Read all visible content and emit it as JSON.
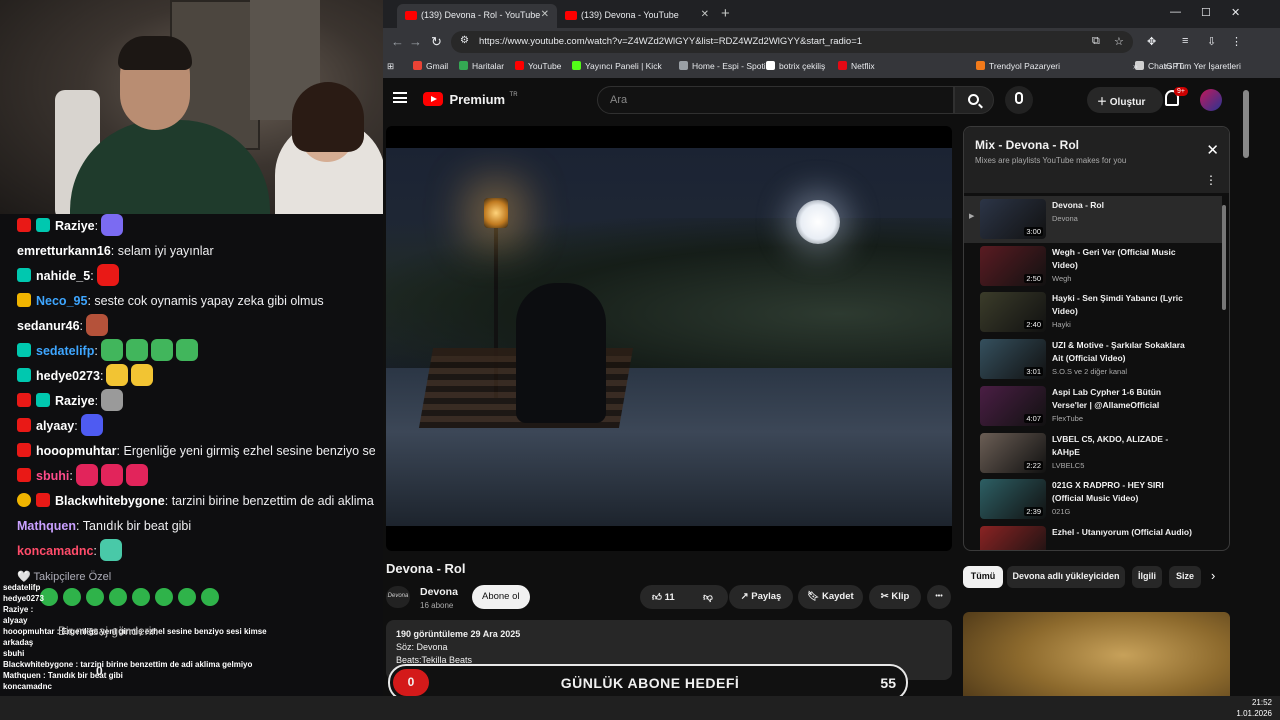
{
  "stream": {
    "chat": [
      {
        "badge": "b-red",
        "badge2": "b-teal",
        "user": "Raziye",
        "color": "#ffffff",
        "sep": ":",
        "text": "",
        "emotes": [
          "#7b6bf2"
        ]
      },
      {
        "badge": "",
        "badge2": "",
        "user": "emretturkann16",
        "color": "#ffffff",
        "sep": ":",
        "text": " selam iyi yayınlar",
        "emotes": []
      },
      {
        "badge": "b-teal",
        "badge2": "",
        "user": "nahide_5",
        "color": "#ffffff",
        "sep": ":",
        "text": "",
        "emotes": [
          "#e91916"
        ]
      },
      {
        "badge": "b-gold",
        "badge2": "",
        "user": "Neco_95",
        "color": "#3ea6ff",
        "sep": ":",
        "text": " seste cok oynamis yapay zeka gibi olmus",
        "emotes": []
      },
      {
        "badge": "",
        "badge2": "",
        "user": "sedanur46",
        "color": "#ffffff",
        "sep": ":",
        "text": "",
        "emotes": [
          "#b5523a"
        ]
      },
      {
        "badge": "b-teal",
        "badge2": "",
        "user": "sedatelifp",
        "color": "#3ea6ff",
        "sep": ":",
        "text": "",
        "emotes": [
          "#41b65c",
          "#41b65c",
          "#41b65c",
          "#41b65c"
        ]
      },
      {
        "badge": "b-teal",
        "badge2": "",
        "user": "hedye0273",
        "color": "#ffffff",
        "sep": ":",
        "text": "",
        "emotes": [
          "#f2c433",
          "#f2c433"
        ]
      },
      {
        "badge": "b-red",
        "badge2": "b-teal",
        "user": "Raziye",
        "color": "#ffffff",
        "sep": ":",
        "text": "",
        "emotes": [
          "#9a9a9a"
        ]
      },
      {
        "badge": "b-red",
        "badge2": "",
        "user": "alyaay",
        "color": "#ffffff",
        "sep": ":",
        "text": "",
        "emotes": [
          "#4e5bf2"
        ]
      },
      {
        "badge": "b-red",
        "badge2": "",
        "user": "hooopmuhtar",
        "color": "#ffffff",
        "sep": ":",
        "text": " Ergenliğe yeni girmiş ezhel sesine benziyo sesi kimse",
        "emotes": []
      },
      {
        "badge": "b-red",
        "badge2": "",
        "user": "sbuhi",
        "color": "#ff4c8b",
        "sep": ":",
        "text": "",
        "emotes": [
          "#e2245b",
          "#e2245b",
          "#e2245b"
        ]
      },
      {
        "badge": "b-coin",
        "badge2": "b-red",
        "user": "Blackwhitebygone",
        "color": "#ffffff",
        "sep": ":",
        "text": " tarzini birine benzettim de adi aklima gelmiyo",
        "emotes": []
      },
      {
        "badge": "",
        "badge2": "",
        "user": "Mathquen",
        "color": "#c9a0ff",
        "sep": ":",
        "text": " Tanıdık bir beat gibi",
        "emotes": []
      },
      {
        "badge": "",
        "badge2": "",
        "user": "koncamadnc",
        "color": "#ff4c6a",
        "sep": ":",
        "text": "",
        "emotes": [
          "#49c9a8"
        ]
      }
    ],
    "followers_only": "🤍 Takipçilere Özel",
    "send_placeholder": "Bir mesaj gönderin",
    "mini_chat": [
      "sedatelifp",
      "hedye0273",
      "Raziye :",
      "alyaay",
      "hooopmuhtar : Ergenliğe yeni girmiş ezhel sesine benziyo sesi kimse",
      "arkadaş",
      "sbuhi",
      "Blackwhitebygone : tarzini birine benzettim de adi aklima gelmiyo",
      "Mathquen : Tanıdık bir beat gibi",
      "koncamadnc"
    ],
    "counter": "0"
  },
  "browser": {
    "tabs": [
      {
        "title": "(139) Devona - Rol - YouTube"
      },
      {
        "title": "(139) Devona - YouTube"
      }
    ],
    "url": "https://www.youtube.com/watch?v=Z4WZd2WlGYY&list=RDZ4WZd2WlGYY&start_radio=1",
    "bookmarks": [
      {
        "label": "Gmail",
        "color": "#ea4335"
      },
      {
        "label": "Haritalar",
        "color": "#34a853"
      },
      {
        "label": "YouTube",
        "color": "#ff0000"
      },
      {
        "label": "Yayıncı Paneli | Kick",
        "color": "#53fc18"
      },
      {
        "label": "Home - Espi - Spoti...",
        "color": "#9aa0a6"
      },
      {
        "label": "botrix çekiliş",
        "color": "#ffffff"
      },
      {
        "label": "Netflix",
        "color": "#e50914"
      },
      {
        "label": "Trendyol Pazaryeri",
        "color": "#f27a1a"
      },
      {
        "label": "ChatGPT",
        "color": "#d0d0d0"
      }
    ],
    "all_bookmarks": "Tüm Yer İşaretleri"
  },
  "youtube": {
    "logo_text": "Premium",
    "logo_region": "TR",
    "search_placeholder": "Ara",
    "create_label": "Oluştur",
    "notif_count": "9+",
    "video": {
      "title": "Devona - Rol",
      "channel": "Devona",
      "channel_avatar_text": "Devona",
      "subs": "16 abone",
      "subscribe": "Abone ol",
      "likes": "11",
      "share": "Paylaş",
      "save": "Kaydet",
      "clip": "Klip",
      "more": "•••",
      "views_date": "190 görüntüleme  29 Ara 2025",
      "desc_line1": "Söz: Devona",
      "desc_line2": "Beats:Tekilla Beats"
    },
    "goal": {
      "left": "0",
      "label": "GÜNLÜK ABONE HEDEFİ",
      "right": "55"
    },
    "playlist": {
      "title": "Mix - Devona - Rol",
      "subtitle": "Mixes are playlists YouTube makes for you",
      "items": [
        {
          "title": "Devona - Rol",
          "channel": "Devona",
          "duration": "3:00",
          "thumb": "#2c3547"
        },
        {
          "title": "Wegh - Geri Ver (Official Music Video)",
          "channel": "Wegh",
          "duration": "2:50",
          "thumb": "#5a1b22"
        },
        {
          "title": "Hayki - Sen Şimdi Yabancı (Lyric Video)",
          "channel": "Hayki",
          "duration": "2:40",
          "thumb": "#3b3c2a"
        },
        {
          "title": "UZI & Motive - Şarkılar Sokaklara Ait (Official Video)",
          "channel": "S.O.S ve 2 diğer kanal",
          "duration": "3:01",
          "thumb": "#35505e"
        },
        {
          "title": "Aspi Lab Cypher 1-6 Bütün Verse'ler | @AllameOfficial",
          "channel": "FlexTube",
          "duration": "4:07",
          "thumb": "#4a1e44"
        },
        {
          "title": "LVBEL C5, AKDO, ALIZADE - kAHpE",
          "channel": "LVBELC5",
          "duration": "2:22",
          "thumb": "#6b5e55"
        },
        {
          "title": "021G X RADPRO - HEY SIRI (Official Music Video)",
          "channel": "021G",
          "duration": "2:39",
          "thumb": "#2d5f64"
        },
        {
          "title": "Ezhel - Utanıyorum (Official Audio)",
          "channel": "",
          "duration": "2:59",
          "thumb": "#8a2323"
        }
      ]
    },
    "chips": [
      "Tümü",
      "Devona adlı yükleyiciden",
      "İlgili",
      "Size"
    ]
  },
  "taskbar": {
    "time": "21:52",
    "date": "1.01.2026"
  }
}
